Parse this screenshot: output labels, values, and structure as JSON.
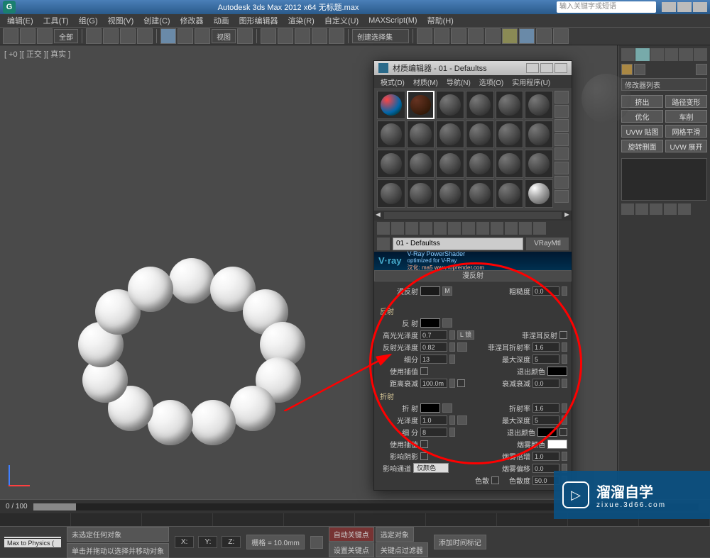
{
  "title": "Autodesk 3ds Max  2012 x64  无标题.max",
  "search_placeholder": "输入关键字或短语",
  "menu": [
    "编辑(E)",
    "工具(T)",
    "组(G)",
    "视图(V)",
    "创建(C)",
    "修改器",
    "动画",
    "图形编辑器",
    "渲染(R)",
    "自定义(U)",
    "MAXScript(M)",
    "帮助(H)"
  ],
  "toolbar_dropdown1": "全部",
  "toolbar_dropdown2": "视图",
  "toolbar_dropdown3": "创建选择集",
  "viewport_label": "[ +0 ][ 正交 ][ 真实 ]",
  "cmdpanel": {
    "modifier_list": "修改器列表",
    "buttons": [
      "挤出",
      "路径变形",
      "优化",
      "车削",
      "UVW 贴图",
      "网格平滑",
      "旋转删面",
      "UVW 展开"
    ]
  },
  "matwin": {
    "title": "材质编辑器 - 01 - Defaultss",
    "menu": [
      "模式(D)",
      "材质(M)",
      "导航(N)",
      "选项(O)",
      "实用程序(U)"
    ],
    "material_name": "01 - Defaultss",
    "material_type": "VRayMtl",
    "banner_logo": "V·ray",
    "banner_text1": "V-Ray PowerShader",
    "banner_text2": "optimized for V-Ray",
    "banner_text3": "汉化: ma5  www.toprender.com",
    "diffuse_title": "漫反射",
    "diffuse_label": "漫反射",
    "roughness_label": "粗糙度",
    "roughness_val": "0.0",
    "reflect": {
      "title": "反射",
      "reflect_label": "反 射",
      "hilight_label": "高光光泽度",
      "hilight_val": "0.7",
      "lock_label": "L 锁",
      "fresnel_label": "菲涅耳反射",
      "refl_gloss_label": "反射光泽度",
      "refl_gloss_val": "0.82",
      "fresnel_ior_label": "菲涅耳折射率",
      "fresnel_ior_val": "1.6",
      "subdiv_label": "细分",
      "subdiv_val": "13",
      "maxdepth_label": "最大深度",
      "maxdepth_val": "5",
      "interp_label": "使用插值",
      "exit_label": "退出颜色",
      "dim_label": "距离衰减",
      "dim_val": "100.0m",
      "dimfall_label": "衰减衰减",
      "dimfall_val": "0.0"
    },
    "refract": {
      "title": "折射",
      "refract_label": "折 射",
      "ior_label": "折射率",
      "ior_val": "1.6",
      "gloss_label": "光泽度",
      "gloss_val": "1.0",
      "maxdepth_label": "最大深度",
      "maxdepth_val": "5",
      "subdiv_label": "细 分",
      "subdiv_val": "8",
      "exit_label": "退出颜色",
      "interp_label": "使用插值",
      "fog_label": "烟雾颜色",
      "shadow_label": "影响阴影",
      "fogmult_label": "烟雾倍增",
      "fogmult_val": "1.0",
      "channel_label": "影响通道",
      "channel_val": "仅颜色",
      "fogbias_label": "烟雾偏移",
      "fogbias_val": "0.0",
      "dispersion_label": "色散",
      "abbe_label": "色散度",
      "abbe_val": "50.0"
    }
  },
  "timeslider": "0 / 100",
  "status": {
    "left1": " ",
    "left2": "Max to Physics (",
    "msg1": "未选定任何对象",
    "msg2": "单击并拖动以选择并移动对象",
    "x": "X:",
    "y": "Y:",
    "z": "Z:",
    "grid": "栅格 = 10.0mm",
    "autokey": "自动关键点",
    "selset": "选定对象",
    "setkey": "设置关键点",
    "keyfilter": "关键点过滤器",
    "addtime": "添加时间标记"
  },
  "watermark": {
    "big": "溜溜自学",
    "small": "zixue.3d66.com"
  }
}
